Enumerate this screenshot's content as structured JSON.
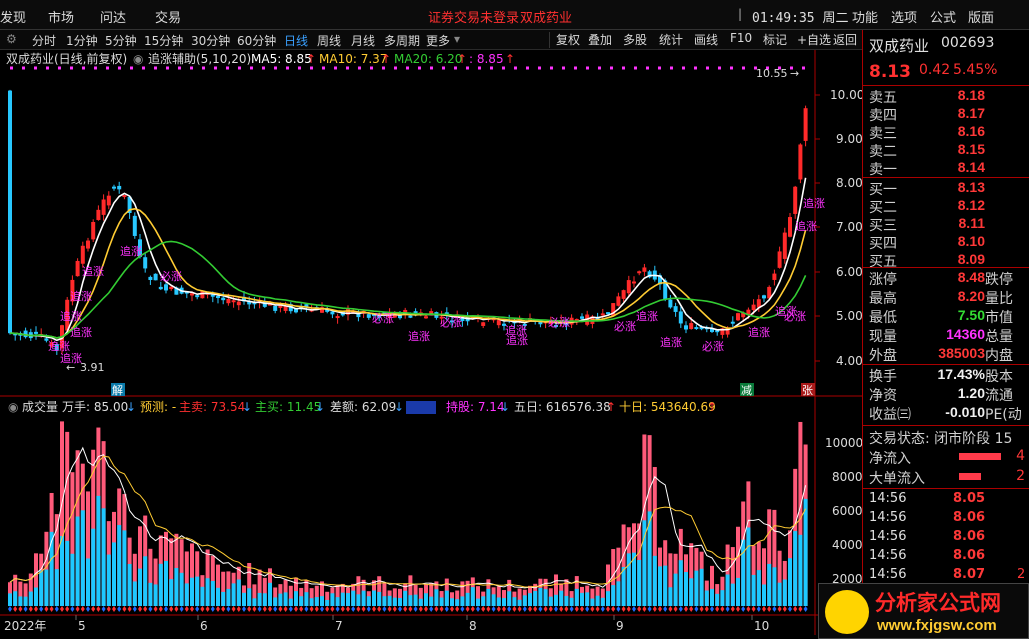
{
  "menu": {
    "left": [
      "发现",
      "市场",
      "问达",
      "交易"
    ],
    "status": "证券交易未登录",
    "stock": "双成药业",
    "clock": "01:49:35 周二",
    "right": [
      "功能",
      "选项",
      "公式",
      "版面"
    ]
  },
  "toolbar": {
    "periods": [
      "分时",
      "1分钟",
      "5分钟",
      "15分钟",
      "30分钟",
      "60分钟",
      "日线",
      "周线",
      "月线",
      "多周期",
      "更多"
    ],
    "active": "日线",
    "tools": [
      "复权",
      "叠加",
      "多股",
      "统计",
      "画线",
      "F10",
      "标记",
      "+自选",
      "返回"
    ]
  },
  "kline": {
    "title": "双成药业(日线,前复权)",
    "indicator": "追涨辅助(5,10,20)",
    "ma5": "MA5: 8.85",
    "ma10": "MA10: 7.37",
    "ma20": "MA20: 6.20",
    "extra": ": 8.85",
    "yticks": [
      "10.00",
      "9.00",
      "8.00",
      "7.00",
      "6.00",
      "5.00",
      "4.00"
    ],
    "high_label": "10.55",
    "low_label": "3.91",
    "signals": [
      "追涨",
      "追涨",
      "追涨",
      "必涨",
      "追涨",
      "追涨",
      "追涨",
      "追涨",
      "必涨",
      "必涨",
      "追涨",
      "追涨",
      "追涨",
      "必涨",
      "必涨",
      "追涨",
      "追涨",
      "必涨",
      "追涨",
      "追涨",
      "必涨",
      "追涨",
      "追涨"
    ],
    "markers": [
      "解",
      "减",
      "张"
    ]
  },
  "volume": {
    "title": "成交量",
    "hand": "万手: 85.00",
    "predict": "预测: -",
    "main_sell": "主卖: 73.54",
    "main_buy": "主买: 11.45",
    "diff": "差额: 62.09",
    "hold": "持股: 7.14",
    "five": "五日: 616576.38",
    "ten": "十日: 543640.69",
    "yticks": [
      "10000",
      "8000",
      "6000",
      "4000",
      "2000"
    ]
  },
  "xaxis": [
    "2022年",
    "5",
    "6",
    "7",
    "8",
    "9",
    "10"
  ],
  "quote": {
    "name": "双成药业",
    "code": "002693",
    "price": "8.13",
    "change": "0.42",
    "pct": "5.45%",
    "asks": [
      {
        "l": "卖五",
        "p": "8.18"
      },
      {
        "l": "卖四",
        "p": "8.17"
      },
      {
        "l": "卖三",
        "p": "8.16"
      },
      {
        "l": "卖二",
        "p": "8.15"
      },
      {
        "l": "卖一",
        "p": "8.14"
      }
    ],
    "bids": [
      {
        "l": "买一",
        "p": "8.13"
      },
      {
        "l": "买二",
        "p": "8.12"
      },
      {
        "l": "买三",
        "p": "8.11"
      },
      {
        "l": "买四",
        "p": "8.10"
      },
      {
        "l": "买五",
        "p": "8.09"
      }
    ],
    "stats": [
      {
        "l": "涨停",
        "v": "8.48",
        "r": "跌停"
      },
      {
        "l": "最高",
        "v": "8.20",
        "r": "量比"
      },
      {
        "l": "最低",
        "v": "7.50",
        "r": "市值"
      },
      {
        "l": "现量",
        "v": "14360",
        "r": "总量"
      },
      {
        "l": "外盘",
        "v": "385003",
        "r": "内盘"
      }
    ],
    "stats2": [
      {
        "l": "换手",
        "v": "17.43%",
        "r": "股本"
      },
      {
        "l": "净资",
        "v": "1.20",
        "r": "流通"
      },
      {
        "l": "收益㈢",
        "v": "-0.010",
        "r": "PE(动"
      }
    ],
    "trade_state": "交易状态: 闭市阶段 15",
    "flows": [
      {
        "l": "净流入",
        "v": "4"
      },
      {
        "l": "大单流入",
        "v": "2"
      }
    ],
    "ticks": [
      {
        "t": "14:56",
        "p": "8.05"
      },
      {
        "t": "14:56",
        "p": "8.06"
      },
      {
        "t": "14:56",
        "p": "8.06"
      },
      {
        "t": "14:56",
        "p": "8.06"
      },
      {
        "t": "14:56",
        "p": "8.07",
        "v": "2"
      }
    ]
  },
  "logo": {
    "name": "分析家公式网",
    "url": "www.fxjgsw.com"
  },
  "colors": {
    "up": "#ff2a2a",
    "down": "#28c8ff",
    "ma5": "#ffffff",
    "ma10": "#ffcc33",
    "ma20": "#33cc33",
    "signal": "#ff33ff"
  }
}
